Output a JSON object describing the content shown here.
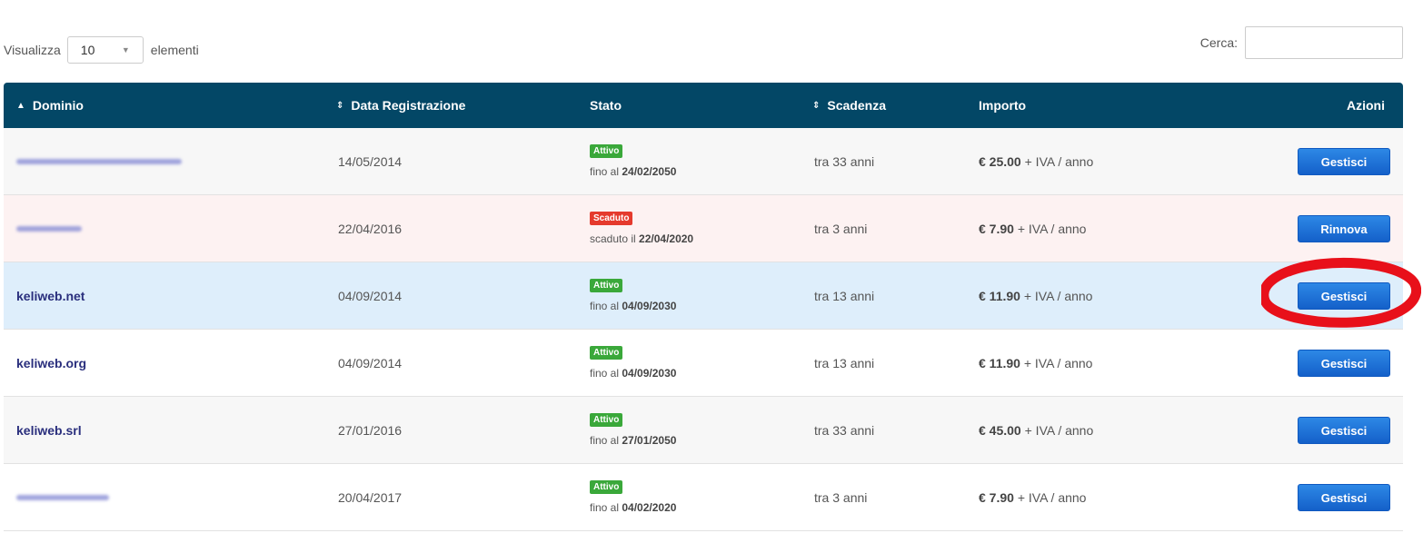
{
  "length": {
    "label_before": "Visualizza",
    "value": "10",
    "label_after": "elementi"
  },
  "search": {
    "label": "Cerca:",
    "value": ""
  },
  "headers": {
    "domain": "Dominio",
    "registration": "Data Registrazione",
    "status": "Stato",
    "expiry": "Scadenza",
    "amount": "Importo",
    "actions": "Azioni"
  },
  "rows": [
    {
      "domain": "",
      "domain_hidden": true,
      "registration": "14/05/2014",
      "badge": "Attivo",
      "badge_color": "#3aa83a",
      "note_prefix": "fino al",
      "note_date": "24/02/2050",
      "expiry": "tra 33 anni",
      "price": "€ 25.00",
      "price_suffix": "+ IVA / anno",
      "action": "Gestisci"
    },
    {
      "domain": "",
      "domain_hidden": true,
      "registration": "22/04/2016",
      "badge": "Scaduto",
      "badge_color": "#e53a2d",
      "note_prefix": "scaduto il",
      "note_date": "22/04/2020",
      "expiry": "tra 3 anni",
      "price": "€ 7.90",
      "price_suffix": "+ IVA / anno",
      "action": "Rinnova"
    },
    {
      "domain": "keliweb.net",
      "registration": "04/09/2014",
      "badge": "Attivo",
      "badge_color": "#3aa83a",
      "note_prefix": "fino al",
      "note_date": "04/09/2030",
      "expiry": "tra 13 anni",
      "price": "€ 11.90",
      "price_suffix": "+ IVA / anno",
      "action": "Gestisci"
    },
    {
      "domain": "keliweb.org",
      "registration": "04/09/2014",
      "badge": "Attivo",
      "badge_color": "#3aa83a",
      "note_prefix": "fino al",
      "note_date": "04/09/2030",
      "expiry": "tra 13 anni",
      "price": "€ 11.90",
      "price_suffix": "+ IVA / anno",
      "action": "Gestisci"
    },
    {
      "domain": "keliweb.srl",
      "registration": "27/01/2016",
      "badge": "Attivo",
      "badge_color": "#3aa83a",
      "note_prefix": "fino al",
      "note_date": "27/01/2050",
      "expiry": "tra 33 anni",
      "price": "€ 45.00",
      "price_suffix": "+ IVA / anno",
      "action": "Gestisci"
    },
    {
      "domain": "",
      "domain_hidden": true,
      "registration": "20/04/2017",
      "badge": "Attivo",
      "badge_color": "#3aa83a",
      "note_prefix": "fino al",
      "note_date": "04/02/2020",
      "expiry": "tra 3 anni",
      "price": "€ 7.90",
      "price_suffix": "+ IVA / anno",
      "action": "Gestisci"
    }
  ],
  "colors": {
    "header_bg": "#034766",
    "button": "#1a6fd6",
    "annotation": "#e8101a"
  }
}
